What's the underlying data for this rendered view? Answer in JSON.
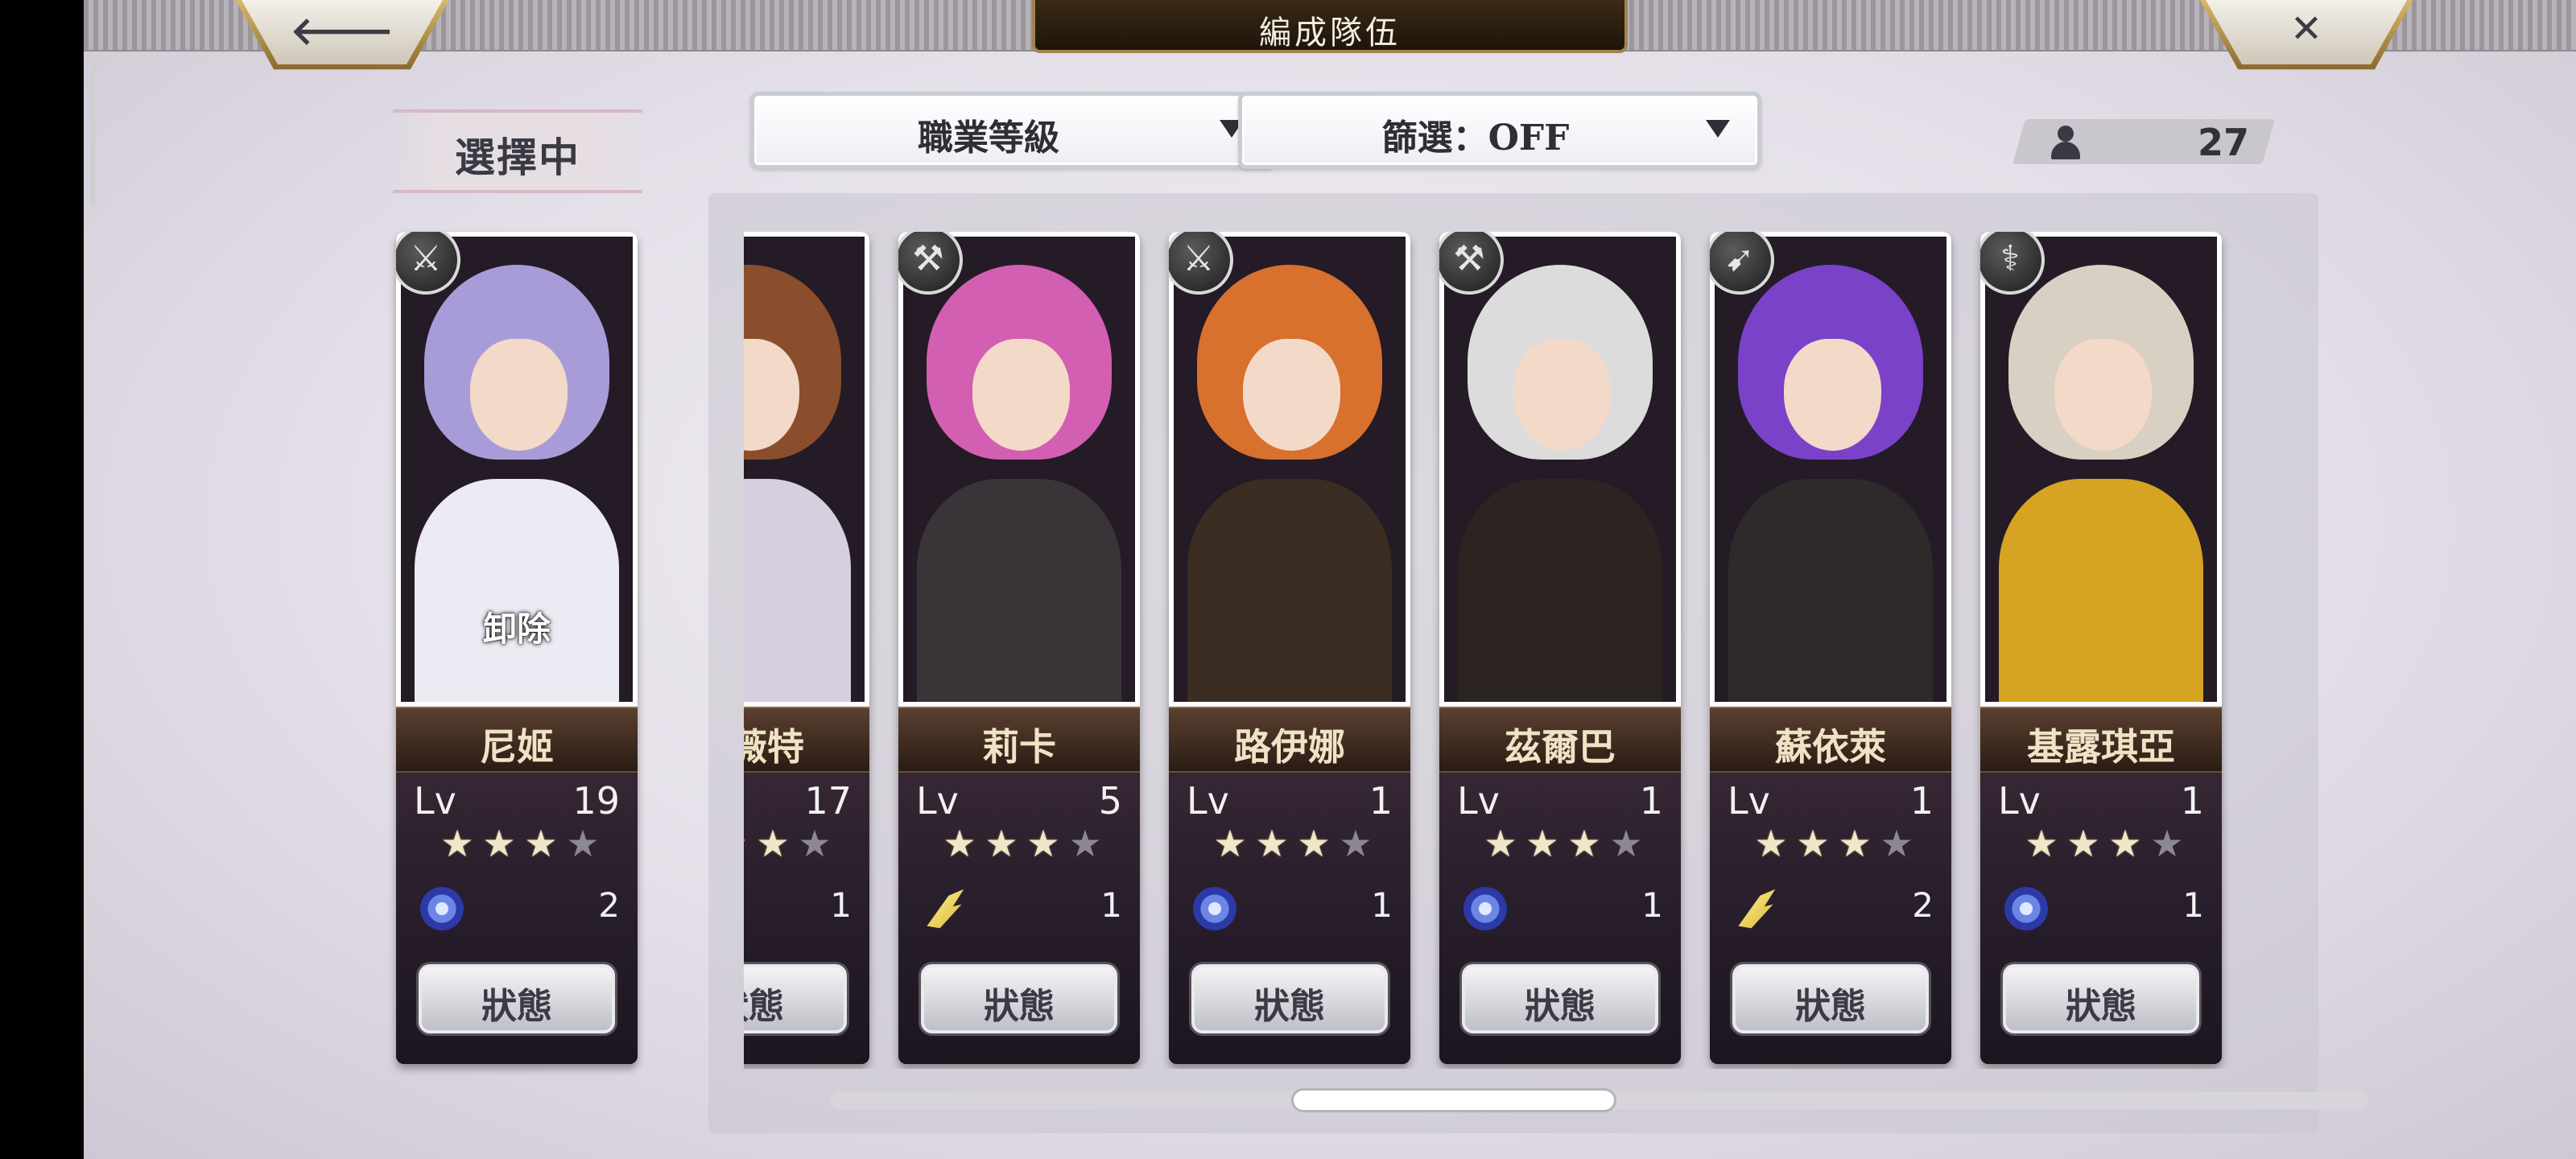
{
  "header": {
    "title": "編成隊伍",
    "back_icon": "arrow-left-icon",
    "close_icon": "close-x-icon",
    "back_glyph": "🡐",
    "close_glyph": "✕"
  },
  "controls": {
    "selecting_label": "選擇中",
    "sort_dropdown": "職業等級",
    "filter_dropdown": "篩選：OFF",
    "unit_count": "27"
  },
  "selected": {
    "name": "尼姬",
    "level_label": "Lv",
    "level": "19",
    "stars_on": 3,
    "stars_total": 4,
    "element": "water",
    "element_count": "2",
    "remove_label": "卸除",
    "status_label": "狀態",
    "class_icon": "sword-icon",
    "class_glyph": "⚔",
    "palette": {
      "hair": "#a89cd8",
      "body": "#eceaf2"
    }
  },
  "roster": [
    {
      "name": "碧薇特",
      "level_label": "Lv",
      "level": "17",
      "stars_on": 3,
      "stars_total": 4,
      "element": "wind",
      "element_count": "1",
      "status_label": "狀態",
      "class_icon": "bow-icon",
      "class_glyph": "➶",
      "palette": {
        "hair": "#8a4e2c",
        "body": "#d6cfe0"
      }
    },
    {
      "name": "莉卡",
      "level_label": "Lv",
      "level": "5",
      "stars_on": 3,
      "stars_total": 4,
      "element": "wind",
      "element_count": "1",
      "status_label": "狀態",
      "class_icon": "hammer-icon",
      "class_glyph": "⚒",
      "palette": {
        "hair": "#d35fb2",
        "body": "#3a3438"
      }
    },
    {
      "name": "路伊娜",
      "level_label": "Lv",
      "level": "1",
      "stars_on": 3,
      "stars_total": 4,
      "element": "water",
      "element_count": "1",
      "status_label": "狀態",
      "class_icon": "sword-icon",
      "class_glyph": "⚔",
      "palette": {
        "hair": "#d8702e",
        "body": "#3c2d22"
      }
    },
    {
      "name": "茲爾巴",
      "level_label": "Lv",
      "level": "1",
      "stars_on": 3,
      "stars_total": 4,
      "element": "water",
      "element_count": "1",
      "status_label": "狀態",
      "class_icon": "axe-icon",
      "class_glyph": "⚒",
      "palette": {
        "hair": "#dcdcdc",
        "body": "#2c2420"
      }
    },
    {
      "name": "蘇依萊",
      "level_label": "Lv",
      "level": "1",
      "stars_on": 3,
      "stars_total": 4,
      "element": "wind",
      "element_count": "2",
      "status_label": "狀態",
      "class_icon": "spear-icon",
      "class_glyph": "➹",
      "palette": {
        "hair": "#7a42c8",
        "body": "#2e2a2c"
      }
    },
    {
      "name": "基露琪亞",
      "level_label": "Lv",
      "level": "1",
      "stars_on": 3,
      "stars_total": 4,
      "element": "water",
      "element_count": "1",
      "status_label": "狀態",
      "class_icon": "staff-icon",
      "class_glyph": "⚕",
      "palette": {
        "hair": "#d8d0c2",
        "body": "#d6a322"
      }
    }
  ],
  "scroll": {
    "position": 0.38
  }
}
